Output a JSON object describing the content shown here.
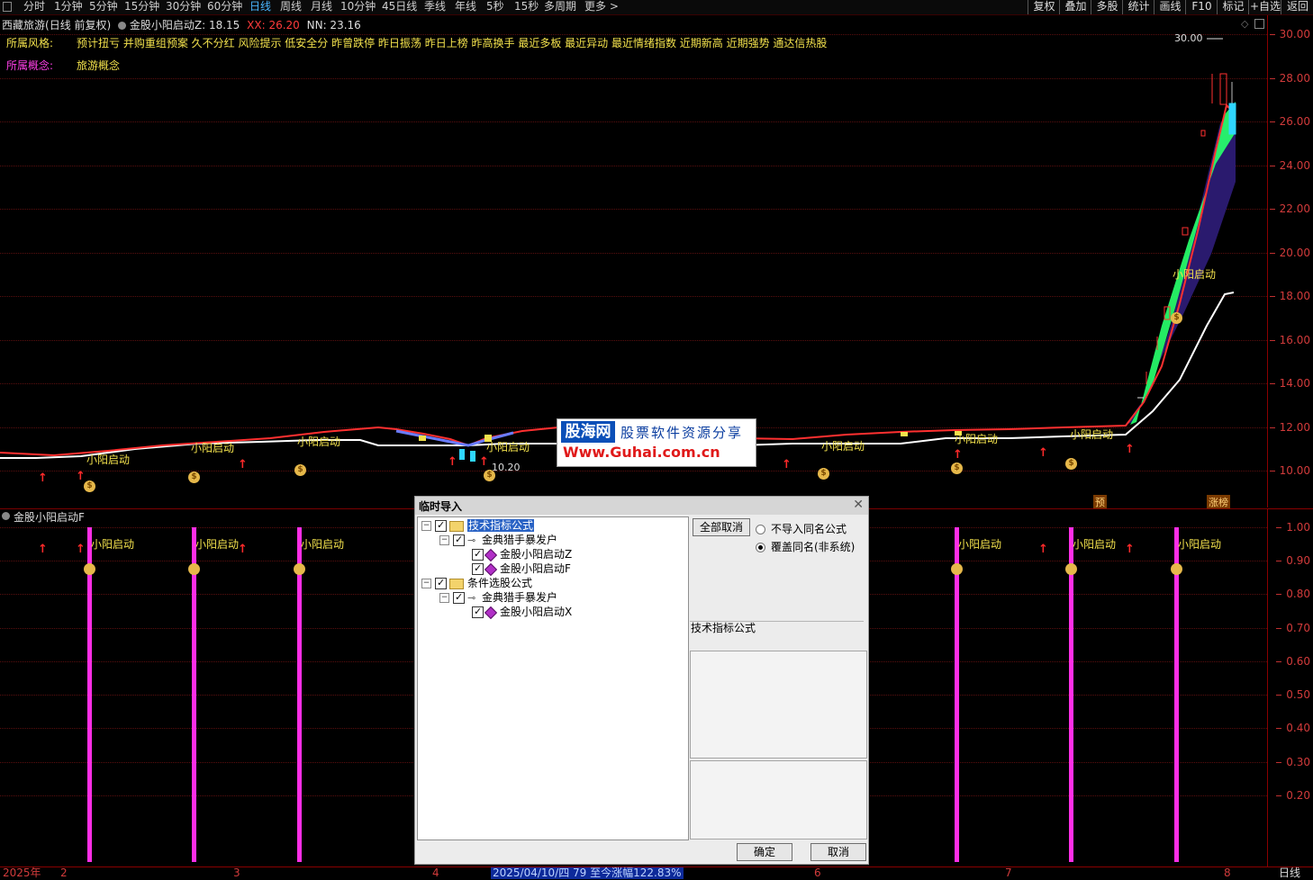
{
  "toolbar": {
    "periods": [
      "分时",
      "1分钟",
      "5分钟",
      "15分钟",
      "30分钟",
      "60分钟",
      "日线",
      "周线",
      "月线",
      "10分钟",
      "45日线",
      "季线",
      "年线",
      "5秒",
      "15秒",
      "多周期",
      "更多 >"
    ],
    "active_period": "日线",
    "right_buttons": [
      "复权",
      "叠加",
      "多股",
      "统计",
      "画线",
      "F10",
      "标记",
      "+自选",
      "返回"
    ]
  },
  "header": {
    "stock_name": "西藏旅游",
    "mode": "(日线 前复权)",
    "indicator": "金股小阳启动Z",
    "value_main": ": 18.15",
    "xx_label": "XX: 26.20",
    "nn_label": "NN: 23.16",
    "style_label": "所属风格:",
    "style_values": "预计扭亏 并购重组预案 久不分红 风险提示 低安全分 昨曾跌停 昨日振荡 昨日上榜 昨高换手 最近多板 最近异动 最近情绪指数 近期新高 近期强势 通达信热股",
    "concept_label": "所属概念:",
    "concept_values": "旅游概念"
  },
  "main_chart": {
    "peak_label": "30.00",
    "low_label": "10.20",
    "signal_label": "小阳启动",
    "bottom_badges": [
      "预",
      "涨榜"
    ],
    "y_ticks": [
      "30.00",
      "28.00",
      "26.00",
      "24.00",
      "22.00",
      "20.00",
      "18.00",
      "16.00",
      "14.00",
      "12.00",
      "10.00"
    ]
  },
  "sub_chart": {
    "indicator_name": "金股小阳启动F",
    "signal_label": "小阳启动",
    "y_ticks": [
      "1.00",
      "0.90",
      "0.80",
      "0.70",
      "0.60",
      "0.50",
      "0.40",
      "0.30",
      "0.20"
    ]
  },
  "time_axis": {
    "labels": [
      "2025年",
      "2",
      "3",
      "4",
      "6",
      "7",
      "8"
    ],
    "range_info": "2025/04/10/四 79 至今涨幅122.83%",
    "period_label": "日线"
  },
  "dialog": {
    "title": "临时导入",
    "tree": [
      {
        "label": "技术指标公式",
        "level": 0
      },
      {
        "label": "金典猎手暴发户",
        "level": 1
      },
      {
        "label": "金股小阳启动Z",
        "level": 2
      },
      {
        "label": "金股小阳启动F",
        "level": 2
      },
      {
        "label": "条件选股公式",
        "level": 0
      },
      {
        "label": "金典猎手暴发户",
        "level": 1
      },
      {
        "label": "金股小阳启动X",
        "level": 2
      }
    ],
    "cancel_all": "全部取消",
    "radio_1": "不导入同名公式",
    "radio_2": "覆盖同名(非系统)",
    "info_label": "技术指标公式",
    "ok": "确定",
    "cancel": "取消"
  },
  "watermark": {
    "site_name": "股海网",
    "slogan": "股票软件资源分享",
    "url": "Www.Guhai.com.cn"
  },
  "colors": {
    "up": "#ff2a2a",
    "signal_text": "#f2e14c",
    "magenta": "#ff2ee6",
    "axis_red": "#d23b3b",
    "ribbon_green": "#27ff6b",
    "ribbon_purple": "#2f1c7a"
  }
}
